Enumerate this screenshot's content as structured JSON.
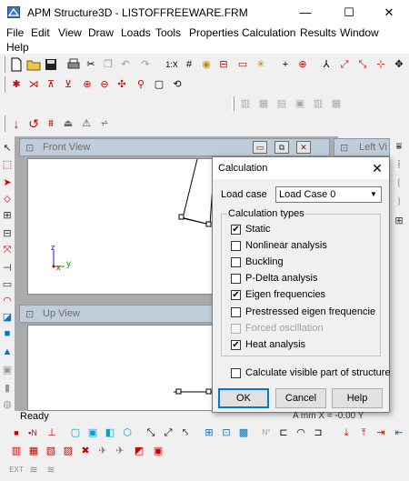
{
  "window": {
    "title": "APM Structure3D - LISTOFFREEWARE.FRM",
    "minimize_glyph": "—",
    "maximize_glyph": "☐",
    "close_glyph": "✕"
  },
  "menu": [
    "File",
    "Edit",
    "View",
    "Draw",
    "Loads",
    "Tools",
    "Properties",
    "Calculation",
    "Results",
    "Window",
    "Help"
  ],
  "views": {
    "front": "Front View",
    "up": "Up View",
    "left": "Left Vi"
  },
  "axes": {
    "z": "z",
    "x": "x",
    "y": "y"
  },
  "dialog": {
    "title": "Calculation",
    "close_glyph": "✕",
    "load_case_label": "Load case",
    "load_case_value": "Load Case 0",
    "group_title": "Calculation types",
    "options": [
      {
        "label": "Static",
        "checked": true,
        "enabled": true
      },
      {
        "label": "Nonlinear analysis",
        "checked": false,
        "enabled": true
      },
      {
        "label": "Buckling",
        "checked": false,
        "enabled": true
      },
      {
        "label": "P-Delta analysis",
        "checked": false,
        "enabled": true
      },
      {
        "label": "Eigen frequencies",
        "checked": true,
        "enabled": true
      },
      {
        "label": "Prestressed eigen frequencie",
        "checked": false,
        "enabled": true
      },
      {
        "label": "Forced oscillation",
        "checked": false,
        "enabled": false
      },
      {
        "label": "Heat analysis",
        "checked": true,
        "enabled": true
      }
    ],
    "visible_part_label": "Calculate visible part of structure",
    "visible_part_checked": false,
    "ok_label": "OK",
    "cancel_label": "Cancel",
    "help_label": "Help"
  },
  "status": {
    "text": "Ready",
    "coord_readout": "A  mm  X = -0.00 Y"
  },
  "colors": {
    "accent": "#0078d7",
    "child_title_bg": "#bfcddb",
    "mdi_bg": "#ababab"
  }
}
